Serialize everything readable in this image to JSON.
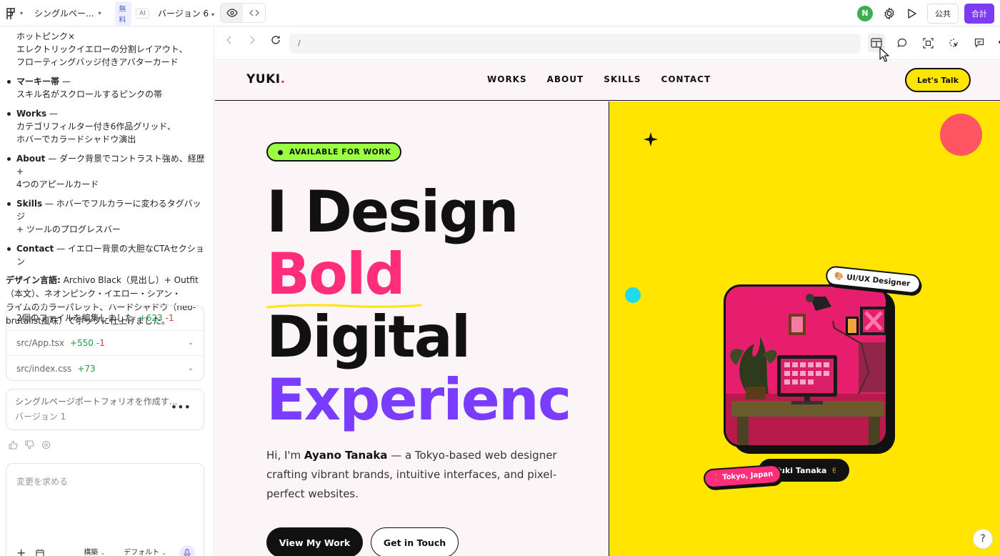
{
  "topbar": {
    "project_name": "シングルペー...",
    "plan_badge": "無料",
    "ai_badge": "AI",
    "version_selector": "バージョン 6",
    "publish_label": "公共",
    "share_label": "合計",
    "avatar_initial": "N"
  },
  "chat": {
    "items": [
      {
        "id": "0",
        "bold": "",
        "text": "ホットピンク×"
      },
      {
        "id": "1",
        "bold": "",
        "text": "エレクトリックイエローの分割レイアウト、"
      },
      {
        "id": "2",
        "bold": "",
        "text": "フローティングバッジ付きアバターカード"
      },
      {
        "id": "3",
        "bold": "マーキー帯",
        "text": " —"
      },
      {
        "id": "4",
        "bold": "",
        "text": "スキル名がスクロールするピンクの帯"
      },
      {
        "id": "5",
        "bold": "Works",
        "text": " —"
      },
      {
        "id": "6",
        "bold": "",
        "text": "カテゴリフィルター付き6作品グリッド、"
      },
      {
        "id": "7",
        "bold": "",
        "text": "ホバーでカラードシャドウ演出"
      },
      {
        "id": "8",
        "bold": "About",
        "text": " — ダーク背景でコントラスト強め、経歴 + "
      },
      {
        "id": "9",
        "bold": "",
        "text": "4つのアピールカード"
      },
      {
        "id": "10",
        "bold": "Skills",
        "text": " — ホバーでフルカラーに変わるタグバッジ"
      },
      {
        "id": "11",
        "bold": "",
        "text": "+ ツールのプログレスバー"
      },
      {
        "id": "12",
        "bold": "Contact",
        "text": " — イエロー背景の大胆なCTAセクション"
      }
    ],
    "design_lang_bold": "デザイン言語:",
    "design_lang_lines": [
      " Archivo Black（見出し）+ Outfit",
      "（本文）、ネオンピンク・イエロー・シアン・",
      "ライムのカラーパレット、ハードシャドウ（neo-",
      "brutalist風味）でポップに仕上げました。"
    ],
    "files_summary": "2個のファイルを編集しました",
    "files_summary_add": "+623",
    "files_summary_del": "-1",
    "files": [
      {
        "name": "src/App.tsx",
        "add": "+550",
        "del": "-1"
      },
      {
        "name": "src/index.css",
        "add": "+73",
        "del": ""
      }
    ],
    "version_card_title": "シングルページポートフォリオを作成す...",
    "version_card_sub": "バージョン 1",
    "input_placeholder": "変更を求める",
    "mode_select": "構築",
    "model_select": "デフォルト"
  },
  "browser": {
    "url": "/"
  },
  "site": {
    "brand": "YUKI",
    "brand_dot": ".",
    "nav": [
      "WORKS",
      "ABOUT",
      "SKILLS",
      "CONTACT"
    ],
    "cta": "Let's Talk",
    "badge": "AVAILABLE FOR WORK",
    "headline": [
      "I Design",
      "Bold",
      "Digital",
      "Experienc"
    ],
    "intro_pre": "Hi, I'm ",
    "intro_name": "Ayano Tanaka",
    "intro_post": " — a Tokyo-based web designer crafting vibrant brands, intuitive interfaces, and pixel-perfect websites.",
    "btn_primary": "View My Work",
    "btn_secondary": "Get in Touch",
    "tag_role": "UI/UX Designer",
    "tag_role_emoji": "🎨",
    "tag_name": "Yuki Tanaka",
    "tag_name_emoji": "✌",
    "tag_location": "Tokyo, Japan",
    "tag_location_emoji": "📍"
  },
  "help_label": "?",
  "colors": {
    "accent_purple": "#7b3cf2",
    "hot_pink": "#ff2d7a",
    "yellow": "#ffe500",
    "lime": "#9bff42",
    "cyan": "#1fd9ef",
    "coral": "#ff5462",
    "violet": "#7a3cff"
  }
}
